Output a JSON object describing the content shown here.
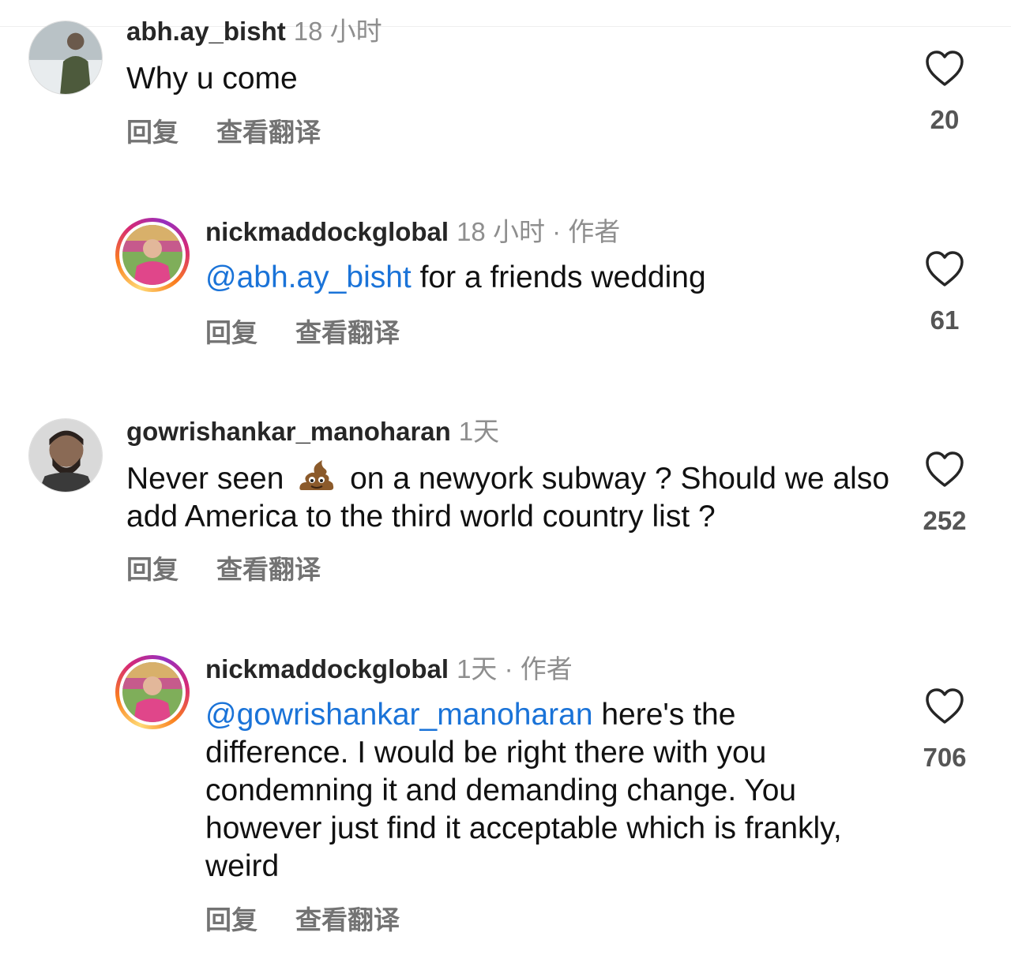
{
  "comments": [
    {
      "username": "abh.ay_bisht",
      "time": "18 小时",
      "text": "Why u come",
      "reply_label": "回复",
      "translate_label": "查看翻译",
      "likes": "20"
    },
    {
      "username": "nickmaddockglobal",
      "time": "18 小时 · 作者",
      "mention": "@abh.ay_bisht",
      "text": " for a friends wedding",
      "reply_label": "回复",
      "translate_label": "查看翻译",
      "likes": "61"
    },
    {
      "username": "gowrishankar_manoharan",
      "time": "1天",
      "text_before": "Never seen ",
      "emoji": "poop-emoji",
      "text_after": " on a newyork subway ? Should we also add America to the third world country list ?",
      "reply_label": "回复",
      "translate_label": "查看翻译",
      "likes": "252"
    },
    {
      "username": "nickmaddockglobal",
      "time": "1天 · 作者",
      "mention": "@gowrishankar_manoharan",
      "text": " here's the difference. I would be right there with you condemning it and demanding change. You however just find it acceptable which is frankly, weird",
      "reply_label": "回复",
      "translate_label": "查看翻译",
      "likes": "706"
    }
  ],
  "icons": {
    "like": "heart-outline-icon"
  },
  "colors": {
    "mention": "#1a73d8",
    "meta": "#8e8e8e",
    "action": "#737373"
  }
}
